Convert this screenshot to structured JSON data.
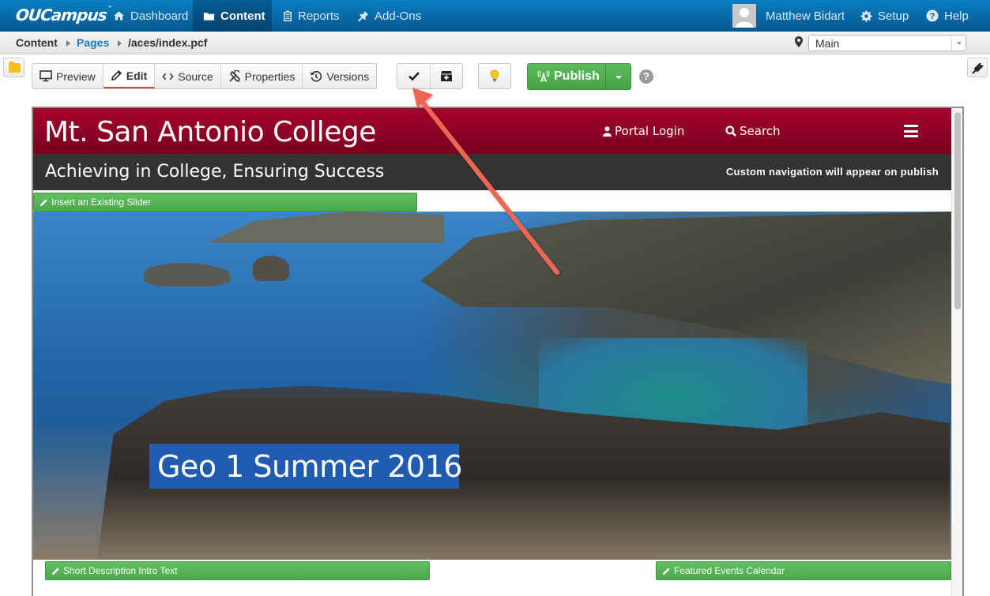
{
  "app": {
    "logo": "OUCampus",
    "nav": [
      {
        "label": "Dashboard",
        "icon": "home-icon",
        "active": false
      },
      {
        "label": "Content",
        "icon": "folder-icon",
        "active": true
      },
      {
        "label": "Reports",
        "icon": "clipboard-icon",
        "active": false
      },
      {
        "label": "Add-Ons",
        "icon": "pushpin-icon",
        "active": false
      }
    ],
    "user": {
      "name": "Matthew Bidart"
    },
    "setup_label": "Setup",
    "help_label": "Help"
  },
  "breadcrumb": {
    "items": [
      {
        "label": "Content",
        "link": false
      },
      {
        "label": "Pages",
        "link": true
      },
      {
        "label": "/aces/index.pcf",
        "link": false
      }
    ]
  },
  "environment": {
    "selected": "Main"
  },
  "toolbar": {
    "view_tabs": [
      {
        "label": "Preview",
        "icon": "monitor-icon",
        "active": false
      },
      {
        "label": "Edit",
        "icon": "pencil-icon",
        "active": true
      },
      {
        "label": "Source",
        "icon": "code-icon",
        "active": false
      },
      {
        "label": "Properties",
        "icon": "tools-icon",
        "active": false
      },
      {
        "label": "Versions",
        "icon": "history-icon",
        "active": false
      }
    ],
    "publish_label": "Publish",
    "help_symbol": "?"
  },
  "page_preview": {
    "site_title": "Mt. San Antonio College",
    "portal_login": "Portal Login",
    "search": "Search",
    "tagline": "Achieving in College, Ensuring Success",
    "nav_note": "Custom navigation will appear on publish",
    "regions": {
      "slider": "Insert an Existing Slider",
      "intro": "Short Description Intro Text",
      "events": "Featured Events Calendar"
    },
    "hero_caption": "Geo 1 Summer 2016"
  },
  "colors": {
    "nav_blue": "#0a6aad",
    "site_red": "#a6022b",
    "region_green": "#4fae4f",
    "publish_green": "#4caf50",
    "caption_blue": "#1e64c8",
    "annotation_arrow": "#ee6652"
  }
}
